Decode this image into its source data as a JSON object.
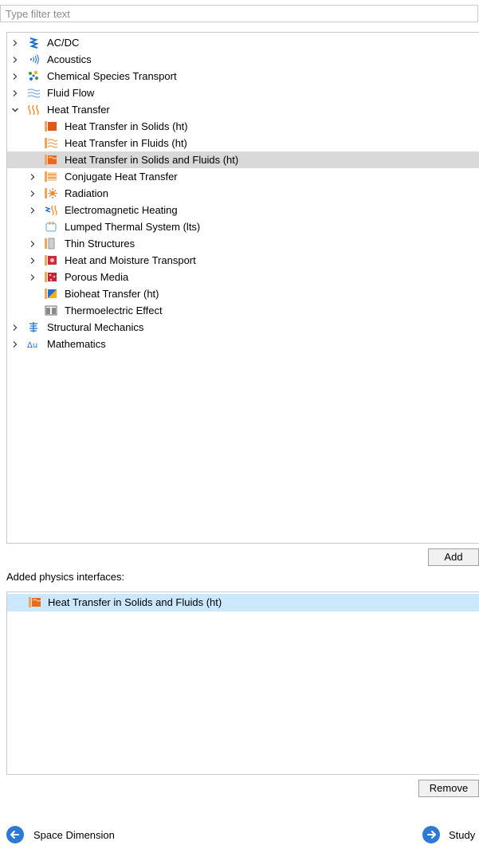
{
  "filter": {
    "placeholder": "Type filter text",
    "value": ""
  },
  "tree": [
    {
      "label": "AC/DC",
      "level": 0,
      "expander": "collapsed",
      "icon": "acdc-icon"
    },
    {
      "label": "Acoustics",
      "level": 0,
      "expander": "collapsed",
      "icon": "acoustics-icon"
    },
    {
      "label": "Chemical Species Transport",
      "level": 0,
      "expander": "collapsed",
      "icon": "chemical-species-icon"
    },
    {
      "label": "Fluid Flow",
      "level": 0,
      "expander": "collapsed",
      "icon": "fluid-flow-icon"
    },
    {
      "label": "Heat Transfer",
      "level": 0,
      "expander": "expanded",
      "icon": "heat-transfer-icon"
    },
    {
      "label": "Heat Transfer in Solids (ht)",
      "level": 1,
      "expander": "none",
      "icon": "heat-solids-icon"
    },
    {
      "label": "Heat Transfer in Fluids (ht)",
      "level": 1,
      "expander": "none",
      "icon": "heat-fluids-icon"
    },
    {
      "label": "Heat Transfer in Solids and Fluids (ht)",
      "level": 1,
      "expander": "none",
      "icon": "heat-solids-fluids-icon",
      "selected": true
    },
    {
      "label": "Conjugate Heat Transfer",
      "level": 1,
      "expander": "collapsed",
      "icon": "conjugate-heat-icon"
    },
    {
      "label": "Radiation",
      "level": 1,
      "expander": "collapsed",
      "icon": "radiation-icon"
    },
    {
      "label": "Electromagnetic Heating",
      "level": 1,
      "expander": "collapsed",
      "icon": "em-heating-icon"
    },
    {
      "label": "Lumped Thermal System (lts)",
      "level": 1,
      "expander": "none",
      "icon": "lumped-thermal-icon"
    },
    {
      "label": "Thin Structures",
      "level": 1,
      "expander": "collapsed",
      "icon": "thin-structures-icon"
    },
    {
      "label": "Heat and Moisture Transport",
      "level": 1,
      "expander": "collapsed",
      "icon": "heat-moisture-icon"
    },
    {
      "label": "Porous Media",
      "level": 1,
      "expander": "collapsed",
      "icon": "porous-media-icon"
    },
    {
      "label": "Bioheat Transfer (ht)",
      "level": 1,
      "expander": "none",
      "icon": "bioheat-icon"
    },
    {
      "label": "Thermoelectric Effect",
      "level": 1,
      "expander": "none",
      "icon": "thermoelectric-icon"
    },
    {
      "label": "Structural Mechanics",
      "level": 0,
      "expander": "collapsed",
      "icon": "structural-mechanics-icon"
    },
    {
      "label": "Mathematics",
      "level": 0,
      "expander": "collapsed",
      "icon": "mathematics-icon"
    }
  ],
  "buttons": {
    "add": "Add",
    "remove": "Remove"
  },
  "added_label": "Added physics interfaces:",
  "added_items": [
    {
      "label": "Heat Transfer in Solids and Fluids (ht)",
      "icon": "heat-solids-fluids-icon"
    }
  ],
  "nav": {
    "back": "Space Dimension",
    "next": "Study"
  },
  "colors": {
    "selection": "#d9d9d9",
    "added_highlight": "#cce8ff",
    "nav_accent": "#2c7ad6"
  }
}
